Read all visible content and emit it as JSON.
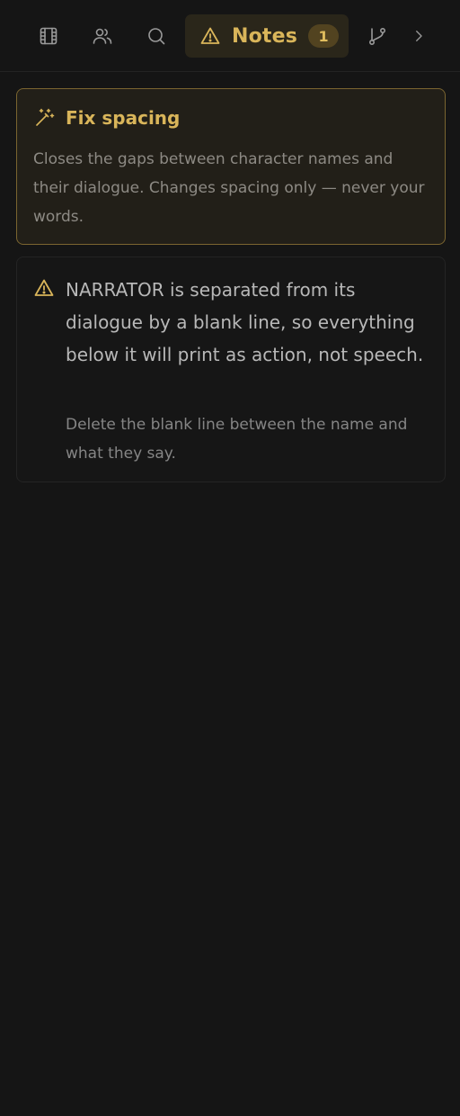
{
  "toolbar": {
    "icons": [
      "film-icon",
      "people-icon",
      "search-icon",
      "branch-icon",
      "chevron-right-icon"
    ],
    "notes_tab": {
      "label": "Notes",
      "count": "1",
      "icon": "warning-icon"
    }
  },
  "fix_card": {
    "icon": "magic-wand-icon",
    "title": "Fix spacing",
    "description": "Closes the gaps between character names and their dialogue. Changes spacing only — never your words."
  },
  "notes": [
    {
      "icon": "warning-icon",
      "message": "NARRATOR is separated from its dialogue by a blank line, so everything below it will print as action, not speech.",
      "hint": "Delete the blank line between the name and what they say."
    }
  ],
  "colors": {
    "background": "#151515",
    "accent": "#d9b55a",
    "accent_bg": "#2a261a",
    "card_border_accent": "#7b6530",
    "text_primary": "#b8b8b8",
    "text_muted": "#858585"
  }
}
